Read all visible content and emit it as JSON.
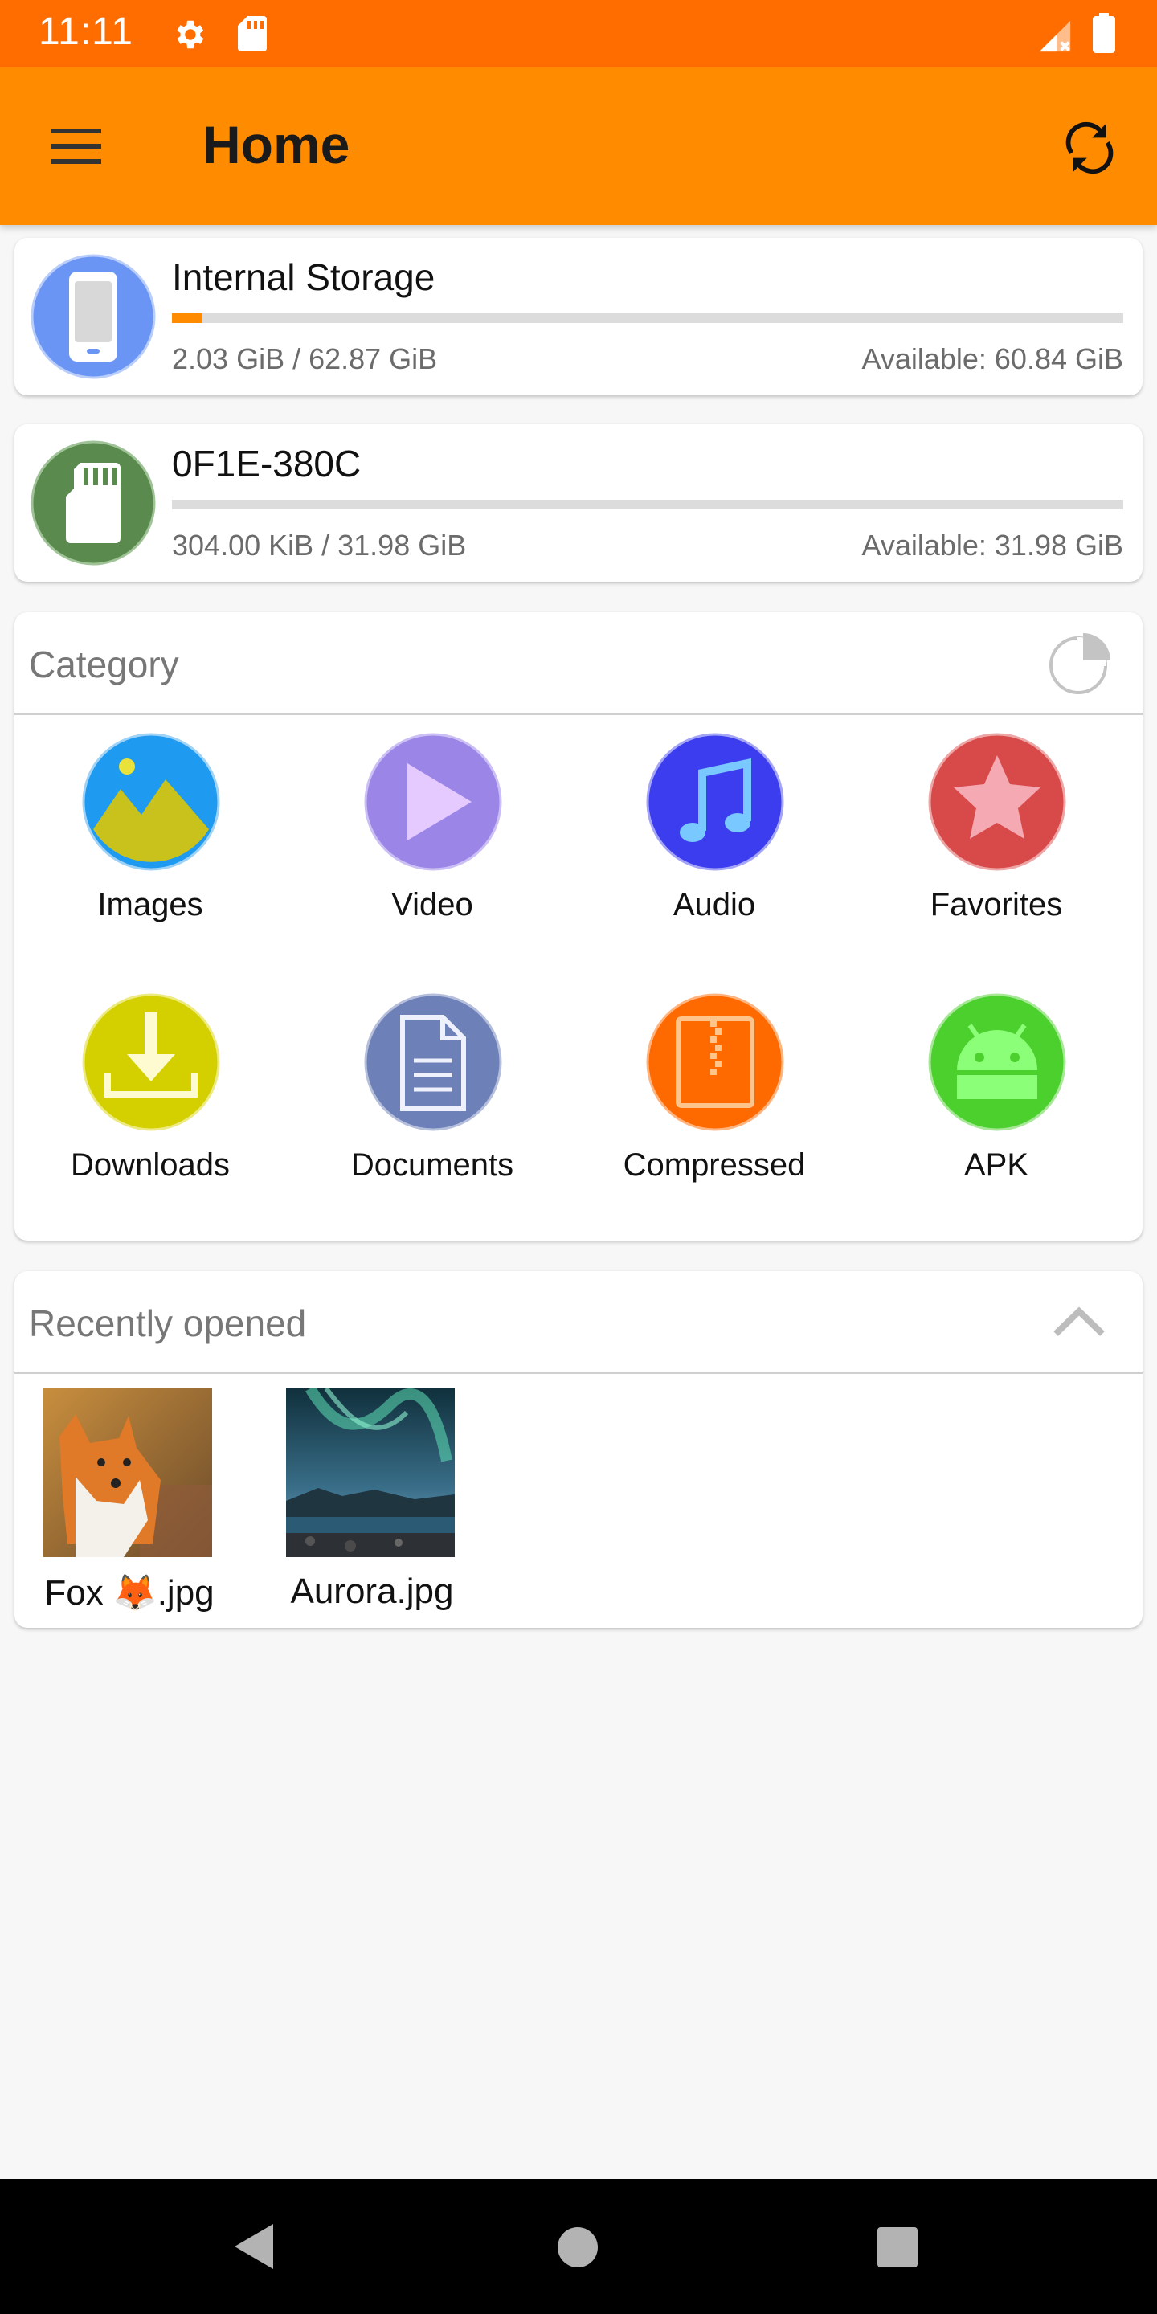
{
  "status_bar": {
    "time": "11:11",
    "icons": [
      "settings-icon",
      "sd-card-icon",
      "signal-icon",
      "battery-icon"
    ],
    "color": "#ff6d00"
  },
  "app_bar": {
    "title": "Home",
    "menu_icon": "menu-icon",
    "refresh_icon": "refresh-icon",
    "color": "#ff8c00"
  },
  "storage": [
    {
      "name": "Internal Storage",
      "used": "2.03 GiB / 62.87 GiB",
      "available": "Available: 60.84 GiB",
      "fill_fraction": 0.032,
      "icon": "phone-icon",
      "icon_color": "#6b95f5"
    },
    {
      "name": "0F1E-380C",
      "used": "304.00 KiB / 31.98 GiB",
      "available": "Available: 31.98 GiB",
      "fill_fraction": 0.0,
      "icon": "sd-card-icon",
      "icon_color": "#5b8a4f"
    }
  ],
  "category": {
    "title": "Category",
    "action_icon": "pie-chart-icon",
    "items": [
      {
        "label": "Images",
        "icon": "image-icon",
        "color": "#1e9af0"
      },
      {
        "label": "Video",
        "icon": "play-icon",
        "color": "#9b86e8"
      },
      {
        "label": "Audio",
        "icon": "music-note-icon",
        "color": "#3d3df0"
      },
      {
        "label": "Favorites",
        "icon": "star-icon",
        "color": "#d84a4a"
      },
      {
        "label": "Downloads",
        "icon": "download-icon",
        "color": "#d4d000"
      },
      {
        "label": "Documents",
        "icon": "document-icon",
        "color": "#6e80b8"
      },
      {
        "label": "Compressed",
        "icon": "archive-icon",
        "color": "#ff6a00"
      },
      {
        "label": "APK",
        "icon": "android-icon",
        "color": "#4cd02e"
      }
    ]
  },
  "recent": {
    "title": "Recently opened",
    "action_icon": "chevron-up-icon",
    "items": [
      {
        "name": "Fox 🦊.jpg",
        "thumb": "fox-photo"
      },
      {
        "name": "Aurora.jpg",
        "thumb": "aurora-photo"
      }
    ]
  },
  "nav_bar": {
    "icons": [
      "back-icon",
      "home-icon",
      "recents-icon"
    ]
  }
}
